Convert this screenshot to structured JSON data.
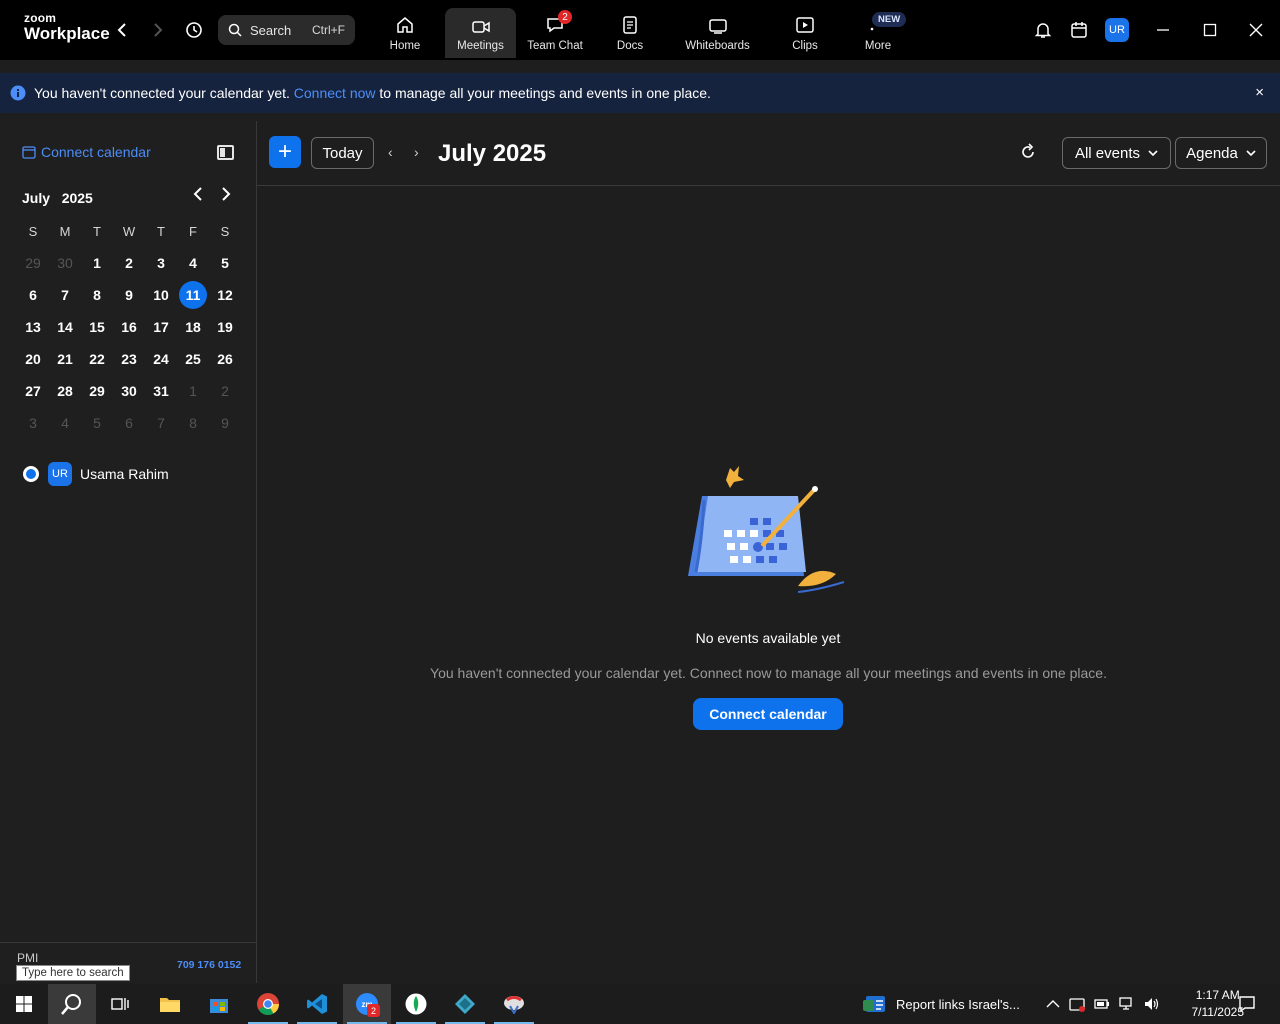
{
  "app": {
    "logo_top": "zoom",
    "logo_bottom": "Workplace"
  },
  "search": {
    "label": "Search",
    "shortcut": "Ctrl+F"
  },
  "tabs": [
    {
      "label": "Home",
      "icon": "home-icon"
    },
    {
      "label": "Meetings",
      "icon": "video-icon",
      "active": true
    },
    {
      "label": "Team Chat",
      "icon": "chat-icon",
      "badge": "2"
    },
    {
      "label": "Docs",
      "icon": "docs-icon"
    },
    {
      "label": "Whiteboards",
      "icon": "whiteboard-icon"
    },
    {
      "label": "Clips",
      "icon": "clips-icon"
    },
    {
      "label": "More",
      "icon": "more-icon",
      "badge": "NEW"
    }
  ],
  "user": {
    "initials": "UR",
    "name": "Usama Rahim"
  },
  "banner": {
    "text_before": "You haven't connected your calendar yet. ",
    "link": "Connect now",
    "text_after": " to manage all your meetings and events in one place.",
    "close": "×"
  },
  "sidebar": {
    "connect_calendar": "Connect calendar",
    "mini_month": "July",
    "mini_year": "2025",
    "weekdays": [
      "S",
      "M",
      "T",
      "W",
      "T",
      "F",
      "S"
    ],
    "weeks": [
      [
        "29",
        "30",
        "1",
        "2",
        "3",
        "4",
        "5"
      ],
      [
        "6",
        "7",
        "8",
        "9",
        "10",
        "11",
        "12"
      ],
      [
        "13",
        "14",
        "15",
        "16",
        "17",
        "18",
        "19"
      ],
      [
        "20",
        "21",
        "22",
        "23",
        "24",
        "25",
        "26"
      ],
      [
        "27",
        "28",
        "29",
        "30",
        "31",
        "1",
        "2"
      ],
      [
        "3",
        "4",
        "5",
        "6",
        "7",
        "8",
        "9"
      ]
    ],
    "today": "11",
    "pmi_label": "PMI",
    "pmi_number": "709 176 0152",
    "tooltip": "Type here to search"
  },
  "toolbar": {
    "plus": "+",
    "today": "Today",
    "prev": "‹",
    "next": "›",
    "title": "July 2025",
    "filter": "All events",
    "view": "Agenda"
  },
  "empty": {
    "title": "No events available yet",
    "subtitle": "You haven't connected your calendar yet. Connect now to manage all your meetings and events in one place.",
    "button": "Connect calendar"
  },
  "taskbar": {
    "news": "Report links Israel's...",
    "time": "1:17 AM",
    "date": "7/11/2025",
    "zoom_badge": "2"
  },
  "colors": {
    "accent": "#0e72ed",
    "link": "#4c8ef7",
    "banner": "#16233f"
  }
}
